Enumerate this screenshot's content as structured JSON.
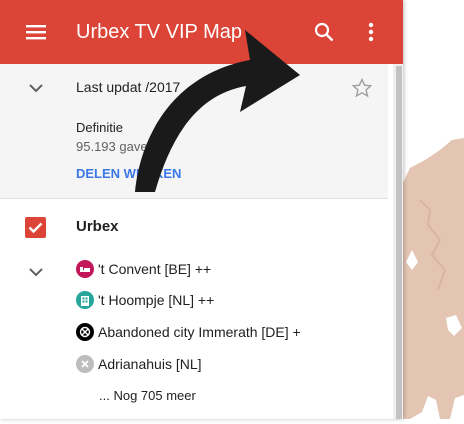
{
  "header": {
    "title": "Urbex TV VIP Map",
    "menu_icon": "menu-icon",
    "search_icon": "search-icon",
    "more_icon": "more-vert-icon"
  },
  "info": {
    "last_updated": "Last updat      /2017",
    "description_label": "Definitie",
    "views": "95.193       gaven",
    "share_link": "DELEN      WERKEN"
  },
  "layer": {
    "title": "Urbex",
    "checked": true,
    "items": [
      {
        "label": "'t Convent [BE] ++",
        "icon": "bed-icon",
        "color": "#c2185b"
      },
      {
        "label": "'t Hoompje [NL] ++",
        "icon": "building-icon",
        "color": "#26a69a"
      },
      {
        "label": "Abandoned city Immerath [DE] +",
        "icon": "prohibited-icon",
        "color": "#000000"
      },
      {
        "label": "Adrianahuis [NL]",
        "icon": "x-icon",
        "color": "#bdbdbd"
      }
    ],
    "more": "... Nog 705 meer"
  },
  "colors": {
    "header": "#db4437",
    "accent_link": "#3b78e7",
    "checkbox": "#db4437",
    "map_land": "#e4c5b3"
  }
}
